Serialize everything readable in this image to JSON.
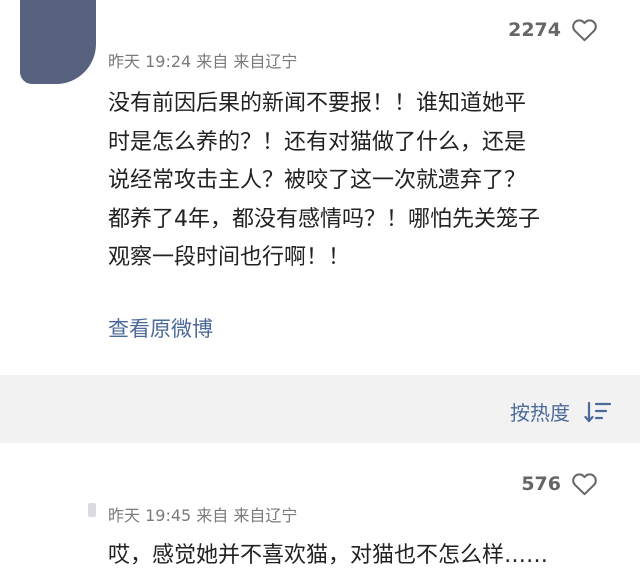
{
  "comments": [
    {
      "timestamp": "昨天 19:24 来自 来自辽宁",
      "likes": "2274",
      "text": "没有前因后果的新闻不要报！！谁知道她平\n时是怎么养的？！还有对猫做了什么，还是\n说经常攻击主人？被咬了这一次就遗弃了？\n都养了4年，都没有感情吗？！哪怕先关笼子\n观察一段时间也行啊！！",
      "view_original": "查看原微博"
    },
    {
      "timestamp": "昨天 19:45 来自 来自辽宁",
      "likes": "576",
      "text": "哎，感觉她并不喜欢猫，对猫也不怎么样……"
    }
  ],
  "sort": {
    "label": "按热度"
  },
  "icons": {
    "like": "heart-outline-icon",
    "sort": "sort-descending-icon"
  },
  "colors": {
    "link": "#4c6a9a",
    "avatar": "#58627f",
    "divider_bar": "#f2f2f3",
    "meta_text": "#7a7a7a"
  }
}
